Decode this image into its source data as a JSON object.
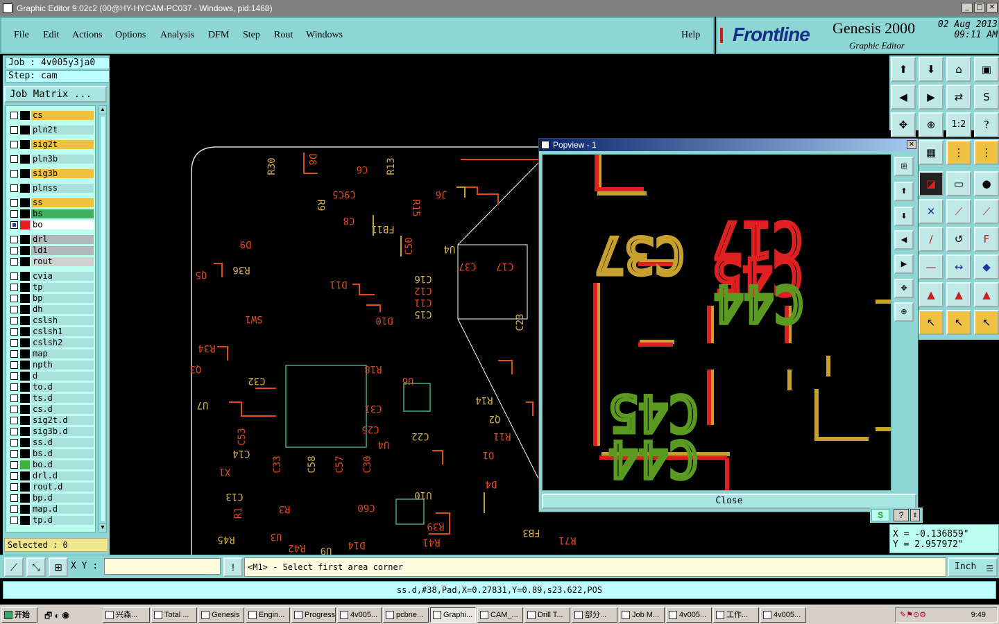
{
  "window": {
    "title": "Graphic Editor 9.02c2 (00@HY-HYCAM-PC037 - Windows, pid:1468)"
  },
  "menu": [
    "File",
    "Edit",
    "Actions",
    "Options",
    "Analysis",
    "DFM",
    "Step",
    "Rout",
    "Windows"
  ],
  "help": "Help",
  "brand": {
    "logo": "Frontline",
    "product": "Genesis 2000",
    "subtitle": "Graphic Editor",
    "date": "02 Aug 2013",
    "time": "09:11 AM"
  },
  "job": {
    "job": "Job : 4v005y3ja0",
    "step": "Step: cam",
    "matrix": "Job Matrix ..."
  },
  "layers": [
    {
      "name": "cs",
      "color": "#f0c040",
      "swatch": "#000"
    },
    {
      "name": "pln2t",
      "color": "#a8e0dc",
      "swatch": "#000"
    },
    {
      "name": "sig2t",
      "color": "#f0c040",
      "swatch": "#000"
    },
    {
      "name": "pln3b",
      "color": "#a8e0dc",
      "swatch": "#000"
    },
    {
      "name": "sig3b",
      "color": "#f0c040",
      "swatch": "#000"
    },
    {
      "name": "plnss",
      "color": "#a8e0dc",
      "swatch": "#000"
    },
    {
      "name": "ss",
      "color": "#f0c040",
      "swatch": "#000"
    },
    {
      "name": "bs",
      "color": "#40b060",
      "swatch": "#000"
    },
    {
      "name": "bo",
      "color": "#ffffff",
      "swatch": "#e02020"
    },
    {
      "name": "drl",
      "color": "#b0b8b8",
      "swatch": "#000"
    },
    {
      "name": "ldi",
      "color": "#b0b8b8",
      "swatch": "#000"
    },
    {
      "name": "rout",
      "color": "#d0d0d0",
      "swatch": "#000"
    },
    {
      "name": "cvia",
      "color": "#a8e0dc",
      "swatch": "#000"
    },
    {
      "name": "tp",
      "color": "#a8e0dc",
      "swatch": "#000"
    },
    {
      "name": "bp",
      "color": "#a8e0dc",
      "swatch": "#000"
    },
    {
      "name": "dh",
      "color": "#a8e0dc",
      "swatch": "#000"
    },
    {
      "name": "cslsh",
      "color": "#a8e0dc",
      "swatch": "#000"
    },
    {
      "name": "cslsh1",
      "color": "#a8e0dc",
      "swatch": "#000"
    },
    {
      "name": "cslsh2",
      "color": "#a8e0dc",
      "swatch": "#000"
    },
    {
      "name": "map",
      "color": "#a8e0dc",
      "swatch": "#000"
    },
    {
      "name": "npth",
      "color": "#a8e0dc",
      "swatch": "#000"
    },
    {
      "name": "d",
      "color": "#a8e0dc",
      "swatch": "#000"
    },
    {
      "name": "to.d",
      "color": "#a8e0dc",
      "swatch": "#000"
    },
    {
      "name": "ts.d",
      "color": "#a8e0dc",
      "swatch": "#000"
    },
    {
      "name": "cs.d",
      "color": "#a8e0dc",
      "swatch": "#000"
    },
    {
      "name": "sig2t.d",
      "color": "#a8e0dc",
      "swatch": "#000"
    },
    {
      "name": "sig3b.d",
      "color": "#a8e0dc",
      "swatch": "#000"
    },
    {
      "name": "ss.d",
      "color": "#a8e0dc",
      "swatch": "#000"
    },
    {
      "name": "bs.d",
      "color": "#a8e0dc",
      "swatch": "#000"
    },
    {
      "name": "bo.d",
      "color": "#a8e0dc",
      "swatch": "#40b040"
    },
    {
      "name": "drl.d",
      "color": "#a8e0dc",
      "swatch": "#000"
    },
    {
      "name": "rout.d",
      "color": "#a8e0dc",
      "swatch": "#000"
    },
    {
      "name": "bp.d",
      "color": "#a8e0dc",
      "swatch": "#000"
    },
    {
      "name": "map.d",
      "color": "#a8e0dc",
      "swatch": "#000"
    },
    {
      "name": "tp.d",
      "color": "#a8e0dc",
      "swatch": "#000"
    }
  ],
  "selected": "Selected : 0",
  "popview": {
    "title": "Popview - 1",
    "close": "Close"
  },
  "coords": {
    "x": "X = -0.136859\"",
    "y": "Y = 2.957972\""
  },
  "command": {
    "xy_label": "X Y :",
    "prompt": "<M1> - Select first area corner",
    "unit": "Inch"
  },
  "status": "ss.d,#38,Pad,X=0.27831,Y=0.89,s23.622,POS",
  "taskbar": {
    "start": "开始",
    "tasks": [
      "兴森...",
      "Total ...",
      "Genesis",
      "Engin...",
      "Progress",
      "4v005...",
      "pcbne...",
      "Graphi...",
      "CAM_...",
      "Drill T...",
      "部分...",
      "Job M...",
      "4v005...",
      "工作...",
      "4v005..."
    ],
    "clock": "9:49"
  },
  "board_labels": [
    "R30",
    "D8",
    "C6",
    "R13",
    "C9C5",
    "J6",
    "R9",
    "C8",
    "R15",
    "FB11",
    "C50",
    "D9",
    "R36",
    "Q5",
    "D11",
    "U4",
    "C37",
    "C17",
    "C16",
    "C12",
    "C11",
    "C15",
    "SW1",
    "D10",
    "C23",
    "R34",
    "Q3",
    "C32",
    "R18",
    "U6",
    "U7",
    "C31",
    "C25",
    "C22",
    "U4",
    "C53",
    "C14",
    "X1",
    "C33",
    "C58",
    "C57",
    "C30",
    "C13",
    "R1",
    "R3",
    "R45",
    "U3",
    "R42",
    "U9",
    "D14",
    "C60",
    "U10",
    "R39",
    "R41",
    "FB3",
    "R71",
    "D4",
    "Q2",
    "R11",
    "O1",
    "R14"
  ],
  "popup_labels": [
    "C37",
    "C17",
    "C45",
    "C44",
    "C45",
    "C44"
  ]
}
